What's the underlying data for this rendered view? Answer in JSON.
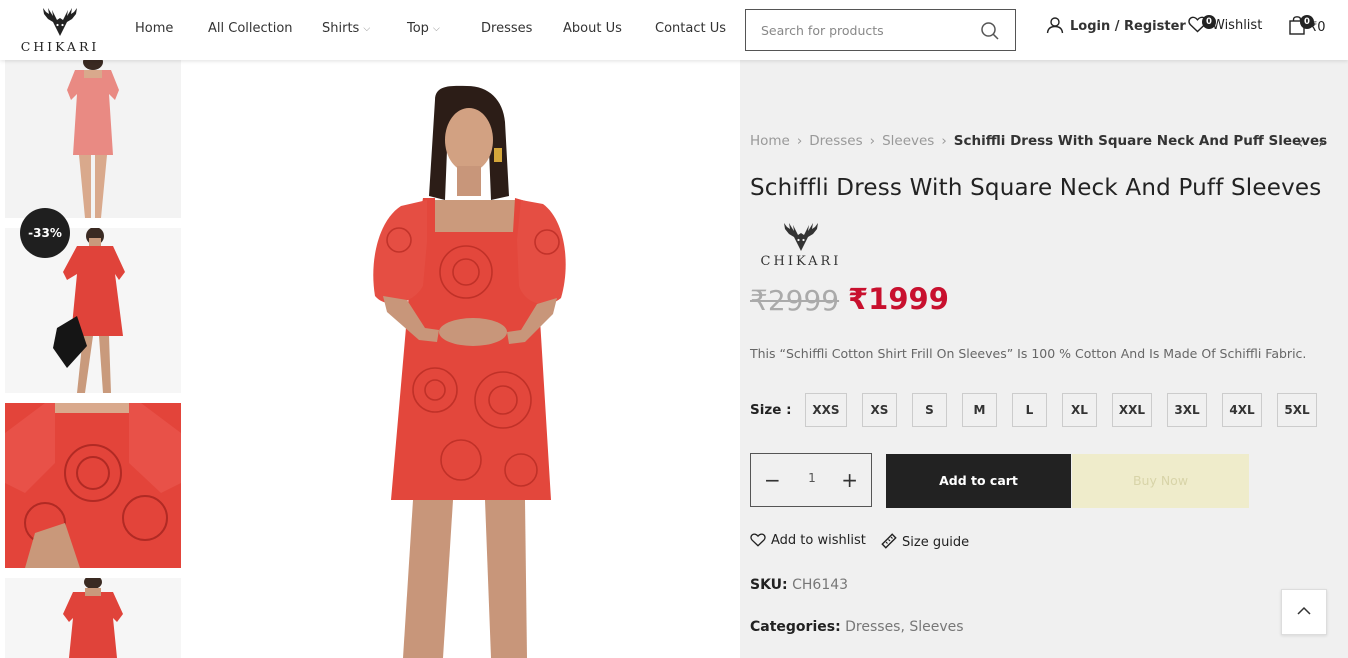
{
  "header": {
    "logo_text": "CHIKARI",
    "nav": [
      {
        "label": "Home",
        "has_dropdown": false
      },
      {
        "label": "All Collection",
        "has_dropdown": false
      },
      {
        "label": "Shirts",
        "has_dropdown": true
      },
      {
        "label": "Top",
        "has_dropdown": true
      },
      {
        "label": "Dresses",
        "has_dropdown": false
      },
      {
        "label": "About Us",
        "has_dropdown": false
      },
      {
        "label": "Contact Us",
        "has_dropdown": false
      }
    ],
    "search": {
      "placeholder": "Search for products",
      "icon": "search-icon"
    },
    "account": {
      "label": "Login / Register",
      "icon": "user-icon"
    },
    "wishlist": {
      "label": "Wishlist",
      "count": "0",
      "icon": "heart-icon"
    },
    "cart": {
      "total": "₹0",
      "count": "0",
      "icon": "bag-icon"
    }
  },
  "gallery": {
    "sale_badge": "-33%",
    "thumbnails": [
      "front-view",
      "pose-with-clutch",
      "detail-close-up",
      "back-view"
    ],
    "main_image": "model-in-red-schiffli-dress"
  },
  "product": {
    "breadcrumb": [
      "Home",
      "Dresses",
      "Sleeves"
    ],
    "breadcrumb_current": "Schiffli Dress With Square Neck And Puff Sleeves",
    "title": "Schiffli Dress With Square Neck And Puff Sleeves",
    "brand_text": "CHIKARI",
    "price_old": "₹2999",
    "price_new": "₹1999",
    "description": "This “Schiffli Cotton Shirt Frill On Sleeves” Is 100 % Cotton And Is Made Of Schiffli Fabric.",
    "size_label": "Size :",
    "sizes": [
      "XXS",
      "XS",
      "S",
      "M",
      "L",
      "XL",
      "XXL",
      "3XL",
      "4XL",
      "5XL"
    ],
    "quantity": "1",
    "add_to_cart": "Add to cart",
    "buy_now": "Buy Now",
    "add_to_wishlist": "Add to wishlist",
    "size_guide": "Size guide",
    "sku_label": "SKU:",
    "sku": "CH6143",
    "categories_label": "Categories:",
    "categories": [
      "Dresses",
      "Sleeves"
    ],
    "accent_color": "#c8102e"
  }
}
